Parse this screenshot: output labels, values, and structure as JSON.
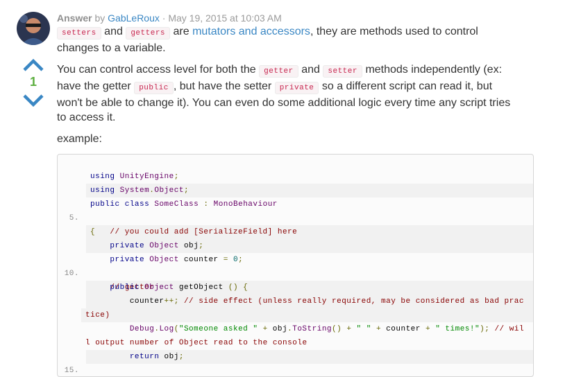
{
  "post": {
    "label": "Answer",
    "by": "by",
    "author": "GabLeRoux",
    "sep": "·",
    "date": "May 19, 2015 at 10:03 AM",
    "votes": "1"
  },
  "icons": {
    "upvote": "arrow-up-icon",
    "downvote": "arrow-down-icon",
    "avatar": "avatar-photo"
  },
  "colors": {
    "link": "#3a87c4",
    "vote_count": "#5cae3f",
    "vote_arrow": "#3a87c4",
    "inline_code": "#c7254e"
  },
  "body": {
    "p1_code1": "setters",
    "p1_and": "and",
    "p1_code2": "getters",
    "p1_are": "are",
    "p1_link": "mutators and accessors",
    "p1_rest": ", they are methods used to control",
    "p1_line2": "changes to a variable.",
    "p2_a": "You can control access level for both the",
    "p2_code1": "getter",
    "p2_and": "and",
    "p2_code2": "setter",
    "p2_b": "methods independently (ex:",
    "p2_c": "have the getter",
    "p2_code3": "public",
    "p2_d": ", but have the setter",
    "p2_code4": "private",
    "p2_e": "so a different script can read it, but",
    "p2_line3": "won't be able to change it). You can even do some additional logic every time any script tries",
    "p2_line4": "to access it.",
    "example": "example:"
  },
  "code": {
    "line_numbers": {
      "n5": "5.",
      "n10": "10.",
      "n15": "15."
    },
    "l1": {
      "kw": "using",
      "rest": "UnityEngine",
      "p": ";"
    },
    "l2": {
      "kw": "using",
      "a": "System",
      "dot": ".",
      "b": "Object",
      "p": ";"
    },
    "l3": {
      "kw1": "public",
      "kw2": "class",
      "name": "SomeClass",
      "colon": ":",
      "base": "MonoBehaviour"
    },
    "l4": {
      "brace": "{"
    },
    "l5": {
      "comment": "// you could add [SerializeField] here"
    },
    "l6": {
      "kw": "private",
      "ty": "Object",
      "name": "obj",
      "p": ";"
    },
    "l7": {
      "kw": "private",
      "ty": "Object",
      "name": "counter",
      "eq": "=",
      "val": "0",
      "p": ";"
    },
    "l8": {
      "comment": "// getter"
    },
    "l9": {
      "kw": "public",
      "ty": "Object",
      "name": "getObject",
      "rest": "() {"
    },
    "l10": {
      "name": "counter",
      "op": "++;",
      "comment": "// side effect (unless really required, may be considered as bad prac"
    },
    "l10b": {
      "comment": "tice)"
    },
    "l11": {
      "a": "Debug",
      "dot": ".",
      "b": "Log",
      "paren": "(",
      "s1": "\"Someone asked \"",
      "plus1": " + ",
      "obj": "obj",
      "dot2": ".",
      "ts": "ToString",
      "call": "()",
      "plus2": " + ",
      "s2": "\" \"",
      "plus3": " + ",
      "counter": "counter",
      "plus4": " + ",
      "s3": "\" times!\"",
      "end": ");",
      "comment": "// wil"
    },
    "l11b": {
      "comment": "l output number of Object read to the console"
    },
    "l12": {
      "kw": "return",
      "rest": "obj",
      "p": ";"
    },
    "l13": {
      "brace": "}"
    }
  }
}
